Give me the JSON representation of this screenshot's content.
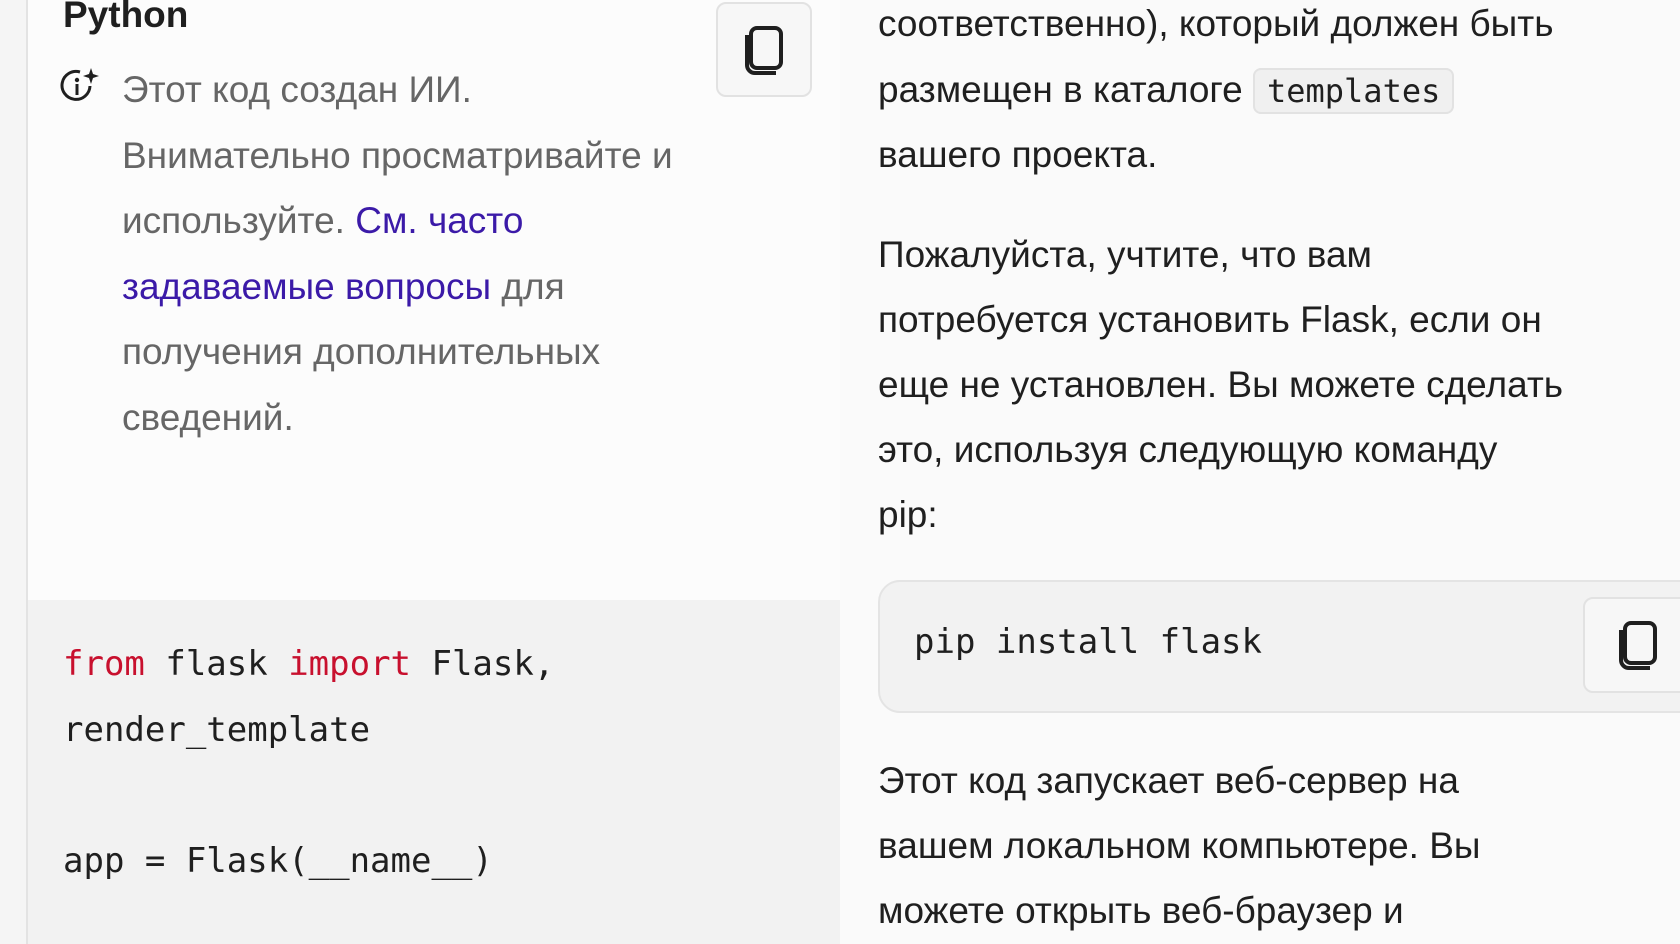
{
  "left_panel": {
    "language": "Python",
    "copy_icon": "copy-icon",
    "notice_icon": "ai-info-sparkle-icon",
    "notice_text_before": "Этот код создан ИИ. Внимательно просматривайте и используйте. ",
    "notice_link": "См. часто задаваемые вопросы",
    "notice_text_after": " для получения дополнительных сведений.",
    "code_lines": [
      {
        "kw1": "from",
        "t1": " flask ",
        "kw2": "import",
        "t2": " Flask,"
      },
      {
        "t": "render_template"
      },
      {
        "t": ""
      },
      {
        "t": "app = Flask(__name__)"
      }
    ]
  },
  "right_panel": {
    "para1_line1": "соответственно), который должен быть",
    "para1_line2": "размещен в каталоге ",
    "para1_code": "templates",
    "para1_line3": "вашего проекта.",
    "para2": [
      "Пожалуйста, учтите, что вам",
      "потребуется установить Flask, если он",
      "еще не установлен. Вы можете сделать",
      "это, используя следующую команду",
      "pip:"
    ],
    "pip_command": "pip install flask",
    "para3": [
      "Этот код запускает веб-сервер на",
      "вашем локальном компьютере. Вы",
      "можете открыть веб-браузер и"
    ]
  },
  "colors": {
    "keyword": "#c8102e",
    "link": "#3b1aa8",
    "notice_text": "#666666"
  }
}
